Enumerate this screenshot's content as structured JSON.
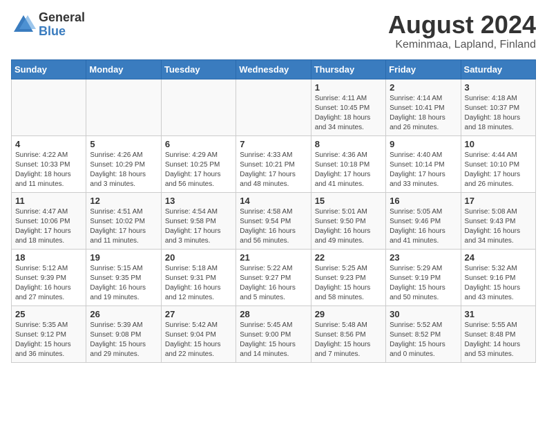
{
  "header": {
    "logo_general": "General",
    "logo_blue": "Blue",
    "title": "August 2024",
    "subtitle": "Keminmaa, Lapland, Finland"
  },
  "days_of_week": [
    "Sunday",
    "Monday",
    "Tuesday",
    "Wednesday",
    "Thursday",
    "Friday",
    "Saturday"
  ],
  "weeks": [
    [
      {
        "day": "",
        "info": ""
      },
      {
        "day": "",
        "info": ""
      },
      {
        "day": "",
        "info": ""
      },
      {
        "day": "",
        "info": ""
      },
      {
        "day": "1",
        "info": "Sunrise: 4:11 AM\nSunset: 10:45 PM\nDaylight: 18 hours\nand 34 minutes."
      },
      {
        "day": "2",
        "info": "Sunrise: 4:14 AM\nSunset: 10:41 PM\nDaylight: 18 hours\nand 26 minutes."
      },
      {
        "day": "3",
        "info": "Sunrise: 4:18 AM\nSunset: 10:37 PM\nDaylight: 18 hours\nand 18 minutes."
      }
    ],
    [
      {
        "day": "4",
        "info": "Sunrise: 4:22 AM\nSunset: 10:33 PM\nDaylight: 18 hours\nand 11 minutes."
      },
      {
        "day": "5",
        "info": "Sunrise: 4:26 AM\nSunset: 10:29 PM\nDaylight: 18 hours\nand 3 minutes."
      },
      {
        "day": "6",
        "info": "Sunrise: 4:29 AM\nSunset: 10:25 PM\nDaylight: 17 hours\nand 56 minutes."
      },
      {
        "day": "7",
        "info": "Sunrise: 4:33 AM\nSunset: 10:21 PM\nDaylight: 17 hours\nand 48 minutes."
      },
      {
        "day": "8",
        "info": "Sunrise: 4:36 AM\nSunset: 10:18 PM\nDaylight: 17 hours\nand 41 minutes."
      },
      {
        "day": "9",
        "info": "Sunrise: 4:40 AM\nSunset: 10:14 PM\nDaylight: 17 hours\nand 33 minutes."
      },
      {
        "day": "10",
        "info": "Sunrise: 4:44 AM\nSunset: 10:10 PM\nDaylight: 17 hours\nand 26 minutes."
      }
    ],
    [
      {
        "day": "11",
        "info": "Sunrise: 4:47 AM\nSunset: 10:06 PM\nDaylight: 17 hours\nand 18 minutes."
      },
      {
        "day": "12",
        "info": "Sunrise: 4:51 AM\nSunset: 10:02 PM\nDaylight: 17 hours\nand 11 minutes."
      },
      {
        "day": "13",
        "info": "Sunrise: 4:54 AM\nSunset: 9:58 PM\nDaylight: 17 hours\nand 3 minutes."
      },
      {
        "day": "14",
        "info": "Sunrise: 4:58 AM\nSunset: 9:54 PM\nDaylight: 16 hours\nand 56 minutes."
      },
      {
        "day": "15",
        "info": "Sunrise: 5:01 AM\nSunset: 9:50 PM\nDaylight: 16 hours\nand 49 minutes."
      },
      {
        "day": "16",
        "info": "Sunrise: 5:05 AM\nSunset: 9:46 PM\nDaylight: 16 hours\nand 41 minutes."
      },
      {
        "day": "17",
        "info": "Sunrise: 5:08 AM\nSunset: 9:43 PM\nDaylight: 16 hours\nand 34 minutes."
      }
    ],
    [
      {
        "day": "18",
        "info": "Sunrise: 5:12 AM\nSunset: 9:39 PM\nDaylight: 16 hours\nand 27 minutes."
      },
      {
        "day": "19",
        "info": "Sunrise: 5:15 AM\nSunset: 9:35 PM\nDaylight: 16 hours\nand 19 minutes."
      },
      {
        "day": "20",
        "info": "Sunrise: 5:18 AM\nSunset: 9:31 PM\nDaylight: 16 hours\nand 12 minutes."
      },
      {
        "day": "21",
        "info": "Sunrise: 5:22 AM\nSunset: 9:27 PM\nDaylight: 16 hours\nand 5 minutes."
      },
      {
        "day": "22",
        "info": "Sunrise: 5:25 AM\nSunset: 9:23 PM\nDaylight: 15 hours\nand 58 minutes."
      },
      {
        "day": "23",
        "info": "Sunrise: 5:29 AM\nSunset: 9:19 PM\nDaylight: 15 hours\nand 50 minutes."
      },
      {
        "day": "24",
        "info": "Sunrise: 5:32 AM\nSunset: 9:16 PM\nDaylight: 15 hours\nand 43 minutes."
      }
    ],
    [
      {
        "day": "25",
        "info": "Sunrise: 5:35 AM\nSunset: 9:12 PM\nDaylight: 15 hours\nand 36 minutes."
      },
      {
        "day": "26",
        "info": "Sunrise: 5:39 AM\nSunset: 9:08 PM\nDaylight: 15 hours\nand 29 minutes."
      },
      {
        "day": "27",
        "info": "Sunrise: 5:42 AM\nSunset: 9:04 PM\nDaylight: 15 hours\nand 22 minutes."
      },
      {
        "day": "28",
        "info": "Sunrise: 5:45 AM\nSunset: 9:00 PM\nDaylight: 15 hours\nand 14 minutes."
      },
      {
        "day": "29",
        "info": "Sunrise: 5:48 AM\nSunset: 8:56 PM\nDaylight: 15 hours\nand 7 minutes."
      },
      {
        "day": "30",
        "info": "Sunrise: 5:52 AM\nSunset: 8:52 PM\nDaylight: 15 hours\nand 0 minutes."
      },
      {
        "day": "31",
        "info": "Sunrise: 5:55 AM\nSunset: 8:48 PM\nDaylight: 14 hours\nand 53 minutes."
      }
    ]
  ]
}
